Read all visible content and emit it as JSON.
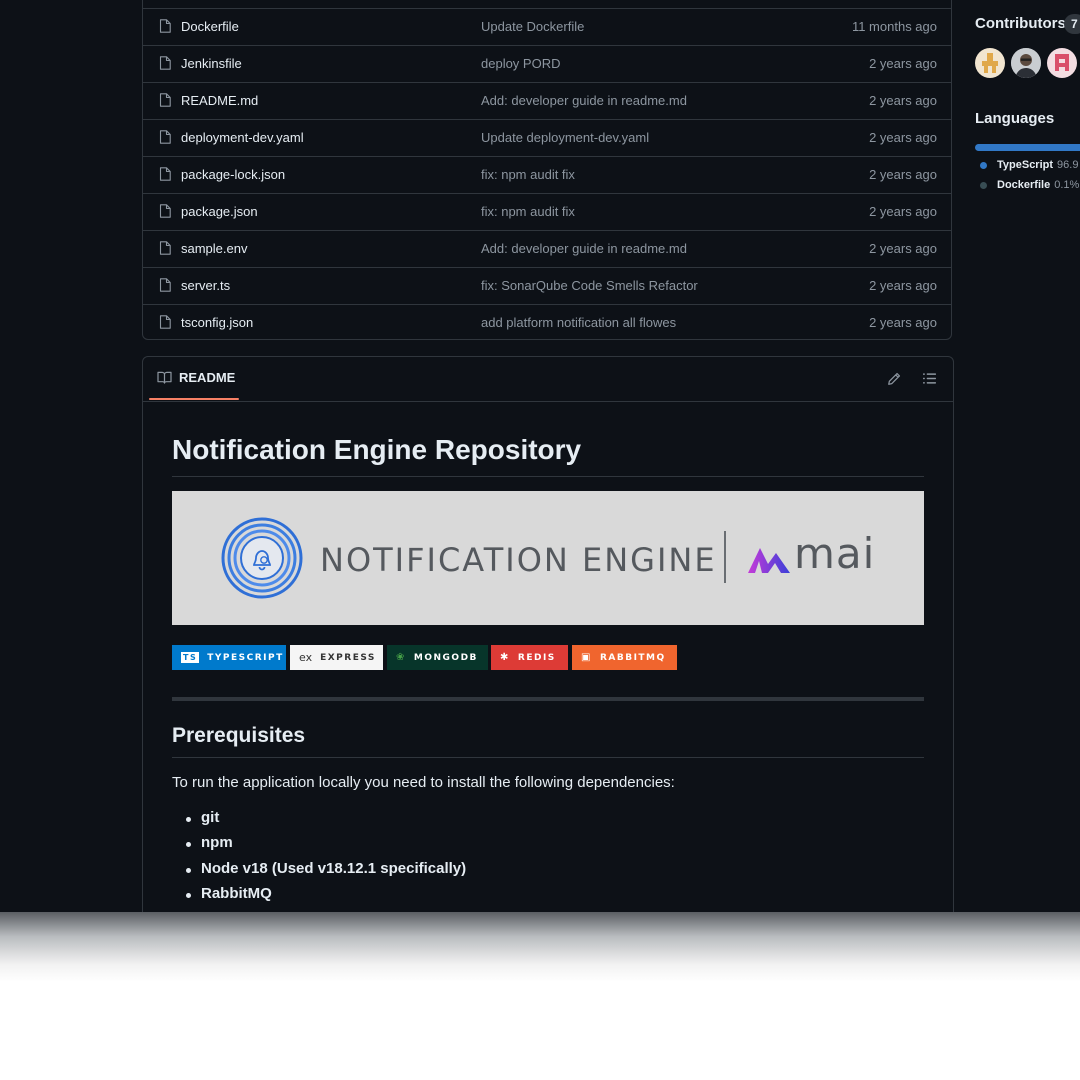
{
  "files": [
    {
      "name": "Dockerfile",
      "message": "Update Dockerfile",
      "age": "11 months ago"
    },
    {
      "name": "Jenkinsfile",
      "message": "deploy PORD",
      "age": "2 years ago"
    },
    {
      "name": "README.md",
      "message": "Add: developer guide in readme.md",
      "age": "2 years ago"
    },
    {
      "name": "deployment-dev.yaml",
      "message": "Update deployment-dev.yaml",
      "age": "2 years ago"
    },
    {
      "name": "package-lock.json",
      "message": "fix: npm audit fix",
      "age": "2 years ago"
    },
    {
      "name": "package.json",
      "message": "fix: npm audit fix",
      "age": "2 years ago"
    },
    {
      "name": "sample.env",
      "message": "Add: developer guide in readme.md",
      "age": "2 years ago"
    },
    {
      "name": "server.ts",
      "message": "fix: SonarQube Code Smells Refactor",
      "age": "2 years ago"
    },
    {
      "name": "tsconfig.json",
      "message": "add platform notification all flowes",
      "age": "2 years ago"
    }
  ],
  "readme": {
    "tab_label": "README",
    "title": "Notification Engine Repository",
    "banner": {
      "text": "NOTIFICATION ENGINE",
      "brand": "mai"
    },
    "badges": [
      {
        "label": "TYPESCRIPT",
        "icon": "TS",
        "bg": "#007acc",
        "fg": "#ffffff"
      },
      {
        "label": "EXPRESS",
        "icon": "ex",
        "bg": "#f5f5f5",
        "fg": "#333333"
      },
      {
        "label": "MONGODB",
        "icon": "leaf-icon",
        "bg": "#07352a",
        "fg": "#ffffff"
      },
      {
        "label": "REDIS",
        "icon": "redis-icon",
        "bg": "#dd3b36",
        "fg": "#ffffff"
      },
      {
        "label": "RABBITMQ",
        "icon": "rabbitmq-icon",
        "bg": "#f0652e",
        "fg": "#ffffff"
      }
    ],
    "prereq_heading": "Prerequisites",
    "prereq_text": "To run the application locally you need to install the following dependencies:",
    "prereq_items": [
      "git",
      "npm",
      "Node v18 (Used v18.12.1 specifically)",
      "RabbitMQ"
    ]
  },
  "sidebar": {
    "contributors_title": "Contributors",
    "contributors_count": "7",
    "languages_title": "Languages",
    "languages": [
      {
        "name": "TypeScript",
        "percent": "96.9",
        "color": "#3178c6"
      },
      {
        "name": "Dockerfile",
        "percent": "0.1%",
        "color": "#384d54"
      }
    ]
  }
}
